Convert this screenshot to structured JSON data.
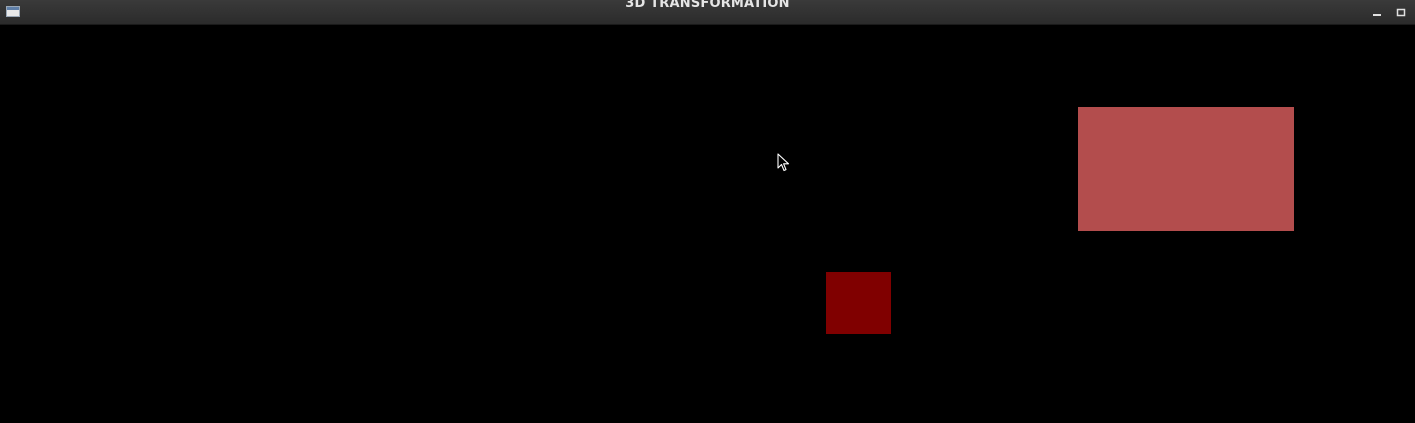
{
  "window": {
    "title": "3D TRANSFORMATION"
  },
  "titlebar": {
    "app_icon": "window-icon",
    "buttons": [
      {
        "name": "minimize",
        "icon": "minimize-icon"
      },
      {
        "name": "maximize",
        "icon": "maximize-icon"
      }
    ]
  },
  "canvas": {
    "background": "#000000",
    "shapes": [
      {
        "name": "large-rectangle",
        "color": "#b34d4d"
      },
      {
        "name": "small-square",
        "color": "#800000"
      }
    ]
  },
  "cursor": {
    "icon": "arrow-cursor-icon"
  }
}
